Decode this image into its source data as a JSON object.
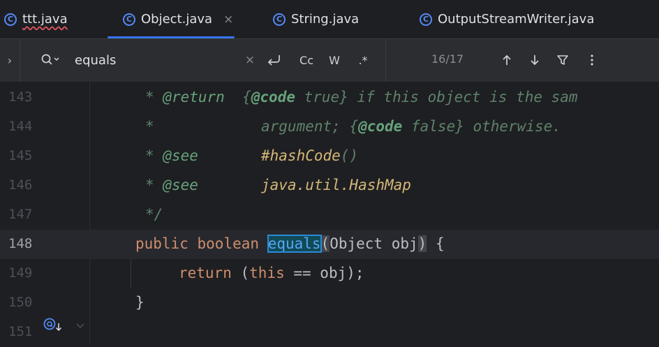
{
  "tabs": [
    {
      "label": "ttt.java",
      "error": true,
      "active": false
    },
    {
      "label": "Object.java",
      "active": true,
      "close": "×"
    },
    {
      "label": "String.java",
      "active": false
    },
    {
      "label": "OutputStreamWriter.java",
      "active": false
    }
  ],
  "search": {
    "expand": "›",
    "query": "equals",
    "clear": "×",
    "regex_label": ".*",
    "match_case_label": "Cc",
    "words_label": "W",
    "count": "16/17"
  },
  "editor": {
    "current_line": 148,
    "lines": [
      {
        "num": "143"
      },
      {
        "num": "144"
      },
      {
        "num": "145"
      },
      {
        "num": "146"
      },
      {
        "num": "147"
      },
      {
        "num": "148"
      },
      {
        "num": "149"
      },
      {
        "num": "150"
      },
      {
        "num": "151"
      }
    ],
    "code": {
      "l143": {
        "star": "* ",
        "tag": "@return",
        "open": "{",
        "codetag": "@code",
        "codeval": " true",
        "close": "}",
        "rest": " if this object is the sam"
      },
      "l144": {
        "star": "*",
        "open": "argument; {",
        "codetag": "@code",
        "codeval": " false",
        "close": "}",
        "rest": " otherwise."
      },
      "l145": {
        "star": "* ",
        "tag": "@see",
        "ref": "#hashCode",
        "parens": "()"
      },
      "l146": {
        "star": "* ",
        "tag": "@see",
        "ref": "java.util.HashMap"
      },
      "l147": {
        "end": "*/"
      },
      "l148": {
        "kw1": "public",
        "kw2": "boolean",
        "name": "equals",
        "lparen": "(",
        "type": "Object",
        "param": " obj",
        "rparen": ")",
        "brace": " {"
      },
      "l149": {
        "kw": "return",
        "body": " (",
        "this": "this",
        "rest": " == obj);"
      },
      "l150": {
        "brace": "}"
      }
    }
  },
  "colors": {
    "accent": "#3574f0",
    "keyword": "#cf8e6d",
    "method": "#56a8f5",
    "doc": "#5f826b"
  }
}
